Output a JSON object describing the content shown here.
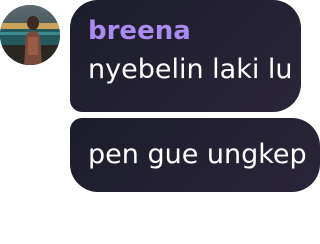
{
  "messages": [
    {
      "sender": "breena",
      "text": "nyebelin laki lu"
    },
    {
      "text": "pen gue ungkep"
    }
  ],
  "colors": {
    "bubble": "#1f1d2c",
    "sender_name": "#a98bf2",
    "message_text": "#ffffff",
    "background": "#ffffff"
  },
  "icons": {
    "avatar": "user-avatar-photo"
  }
}
